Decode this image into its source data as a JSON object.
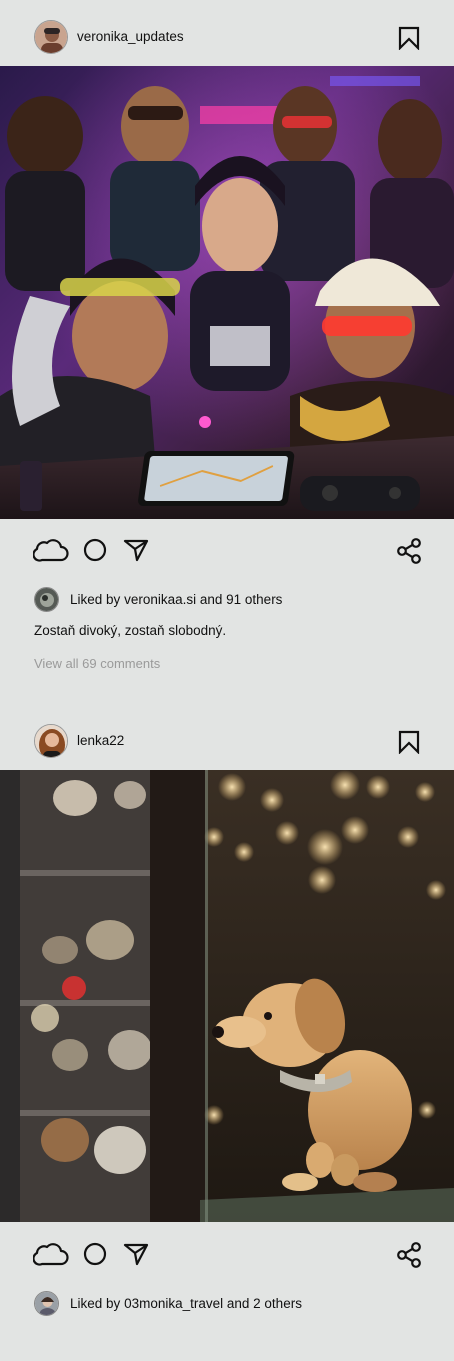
{
  "posts": [
    {
      "username": "veronika_updates",
      "avatar_icon": "user-avatar",
      "image_alt": "illustration",
      "liked_by_user": "veronikaa.si",
      "liked_prefix": "Liked by",
      "liked_suffix": "and 91 others",
      "caption": "Zostaň divoký, zostaň slobodný.",
      "view_comments": "View all 69 comments"
    },
    {
      "username": "lenka22",
      "avatar_icon": "user-avatar",
      "image_alt": "photo",
      "liked_by_user": "03monika_travel",
      "liked_prefix": "Liked by",
      "liked_suffix": "and 2 others"
    }
  ],
  "icons": {
    "like": "cloud-icon",
    "comment": "circle-icon",
    "share_direct": "send-icon",
    "share": "share-icon",
    "save": "bookmark-icon"
  },
  "colors": {
    "background": "#e2e4e3",
    "text": "#111111",
    "muted": "#9a9a9a"
  }
}
